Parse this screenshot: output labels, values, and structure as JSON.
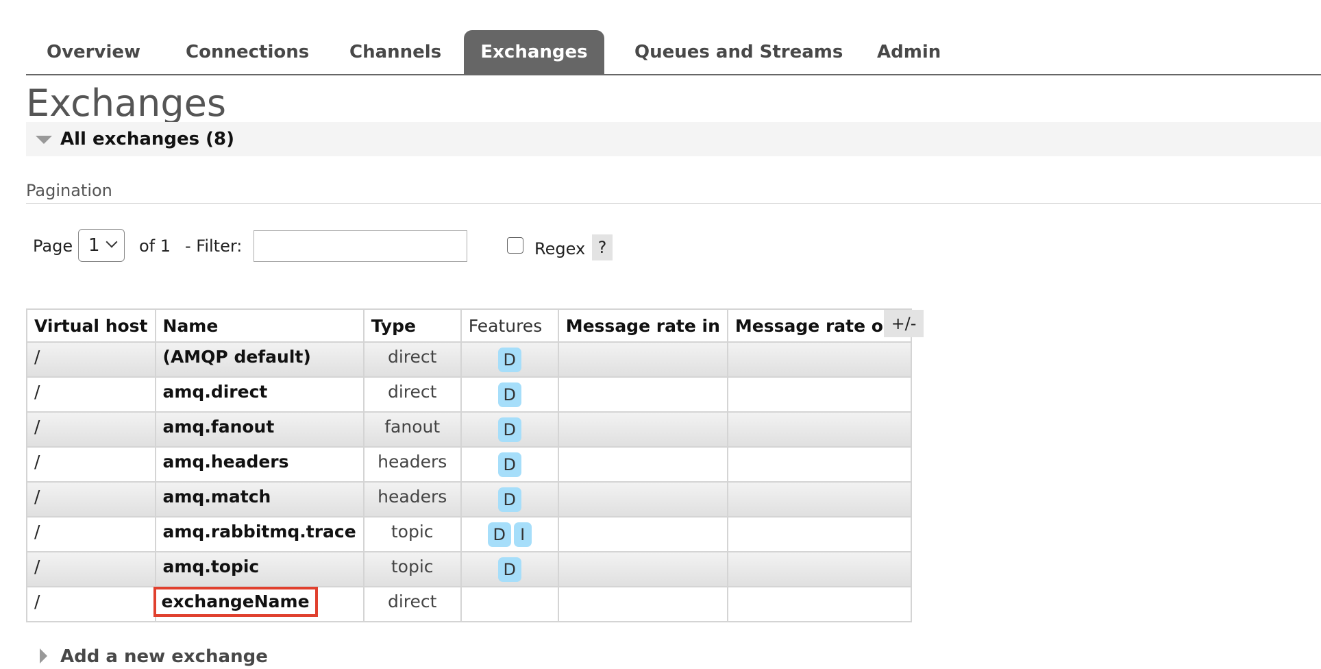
{
  "tabs": [
    {
      "label": "Overview",
      "active": false
    },
    {
      "label": "Connections",
      "active": false
    },
    {
      "label": "Channels",
      "active": false
    },
    {
      "label": "Exchanges",
      "active": true
    },
    {
      "label": "Queues and Streams",
      "active": false
    },
    {
      "label": "Admin",
      "active": false
    }
  ],
  "page_title": "Exchanges",
  "section": {
    "label": "All exchanges (8)"
  },
  "pagination": {
    "label": "Pagination",
    "page_label": "Page",
    "page_value": "1",
    "of_label": "of 1",
    "filter_label": "- Filter:",
    "filter_value": "",
    "regex_label": "Regex",
    "regex_checked": false,
    "help_label": "?"
  },
  "table": {
    "columns": [
      "Virtual host",
      "Name",
      "Type",
      "Features",
      "Message rate in",
      "Message rate out"
    ],
    "toggle_label": "+/-",
    "rows": [
      {
        "vhost": "/",
        "name": "(AMQP default)",
        "type": "direct",
        "features": [
          "D"
        ],
        "rate_in": "",
        "rate_out": ""
      },
      {
        "vhost": "/",
        "name": "amq.direct",
        "type": "direct",
        "features": [
          "D"
        ],
        "rate_in": "",
        "rate_out": ""
      },
      {
        "vhost": "/",
        "name": "amq.fanout",
        "type": "fanout",
        "features": [
          "D"
        ],
        "rate_in": "",
        "rate_out": ""
      },
      {
        "vhost": "/",
        "name": "amq.headers",
        "type": "headers",
        "features": [
          "D"
        ],
        "rate_in": "",
        "rate_out": ""
      },
      {
        "vhost": "/",
        "name": "amq.match",
        "type": "headers",
        "features": [
          "D"
        ],
        "rate_in": "",
        "rate_out": ""
      },
      {
        "vhost": "/",
        "name": "amq.rabbitmq.trace",
        "type": "topic",
        "features": [
          "D",
          "I"
        ],
        "rate_in": "",
        "rate_out": ""
      },
      {
        "vhost": "/",
        "name": "amq.topic",
        "type": "topic",
        "features": [
          "D"
        ],
        "rate_in": "",
        "rate_out": ""
      },
      {
        "vhost": "/",
        "name": "exchangeName",
        "type": "direct",
        "features": [],
        "rate_in": "",
        "rate_out": "",
        "highlighted": true
      }
    ]
  },
  "add_section": {
    "label": "Add a new exchange"
  },
  "colors": {
    "active_tab_bg": "#666666",
    "badge_bg": "#a6defa",
    "highlight_border": "#e0402e"
  }
}
